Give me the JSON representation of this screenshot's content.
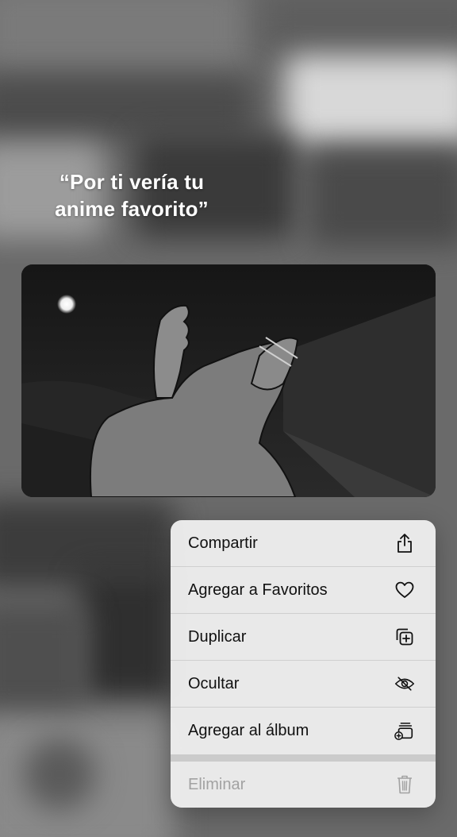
{
  "overlay": {
    "quote": "“Por ti vería tu anime favorito”"
  },
  "menu": {
    "items": [
      {
        "label": "Compartir",
        "icon": "share-icon"
      },
      {
        "label": "Agregar a Favoritos",
        "icon": "heart-icon"
      },
      {
        "label": "Duplicar",
        "icon": "duplicate-icon"
      },
      {
        "label": "Ocultar",
        "icon": "eye-slash-icon"
      },
      {
        "label": "Agregar al álbum",
        "icon": "add-to-album-icon"
      }
    ],
    "destructive": {
      "label": "Eliminar",
      "icon": "trash-icon",
      "state": "disabled"
    }
  },
  "colors": {
    "menu_background": "#eeeeee",
    "menu_text": "#111111",
    "disabled_text": "#a2a2a2"
  }
}
